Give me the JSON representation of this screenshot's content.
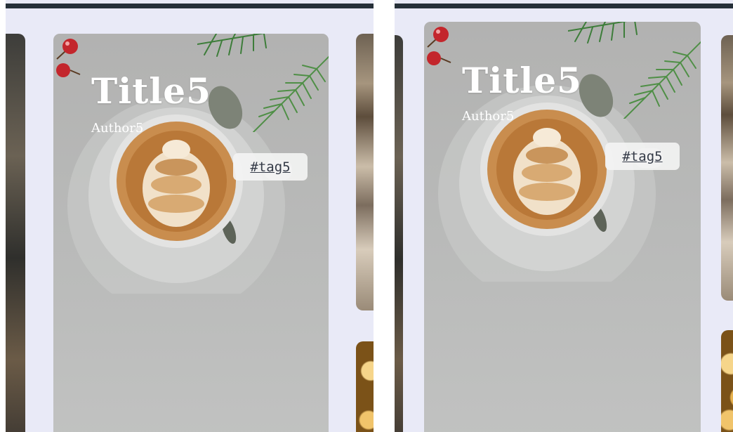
{
  "colors": {
    "page_background": "#e9eaf7",
    "top_bar": "#263039",
    "tag_text": "#343a47",
    "tag_background": "#f3f3f3"
  },
  "panes": [
    {
      "card": {
        "title": "Title5",
        "author": "Author5",
        "tag": "#tag5"
      },
      "image_icons": [
        "pine-branch-icon",
        "cherry-icon",
        "coffee-cup-icon"
      ]
    },
    {
      "card": {
        "title": "Title5",
        "author": "Author5",
        "tag": "#tag5"
      },
      "image_icons": [
        "pine-branch-icon",
        "cherry-icon",
        "coffee-cup-icon"
      ]
    }
  ]
}
